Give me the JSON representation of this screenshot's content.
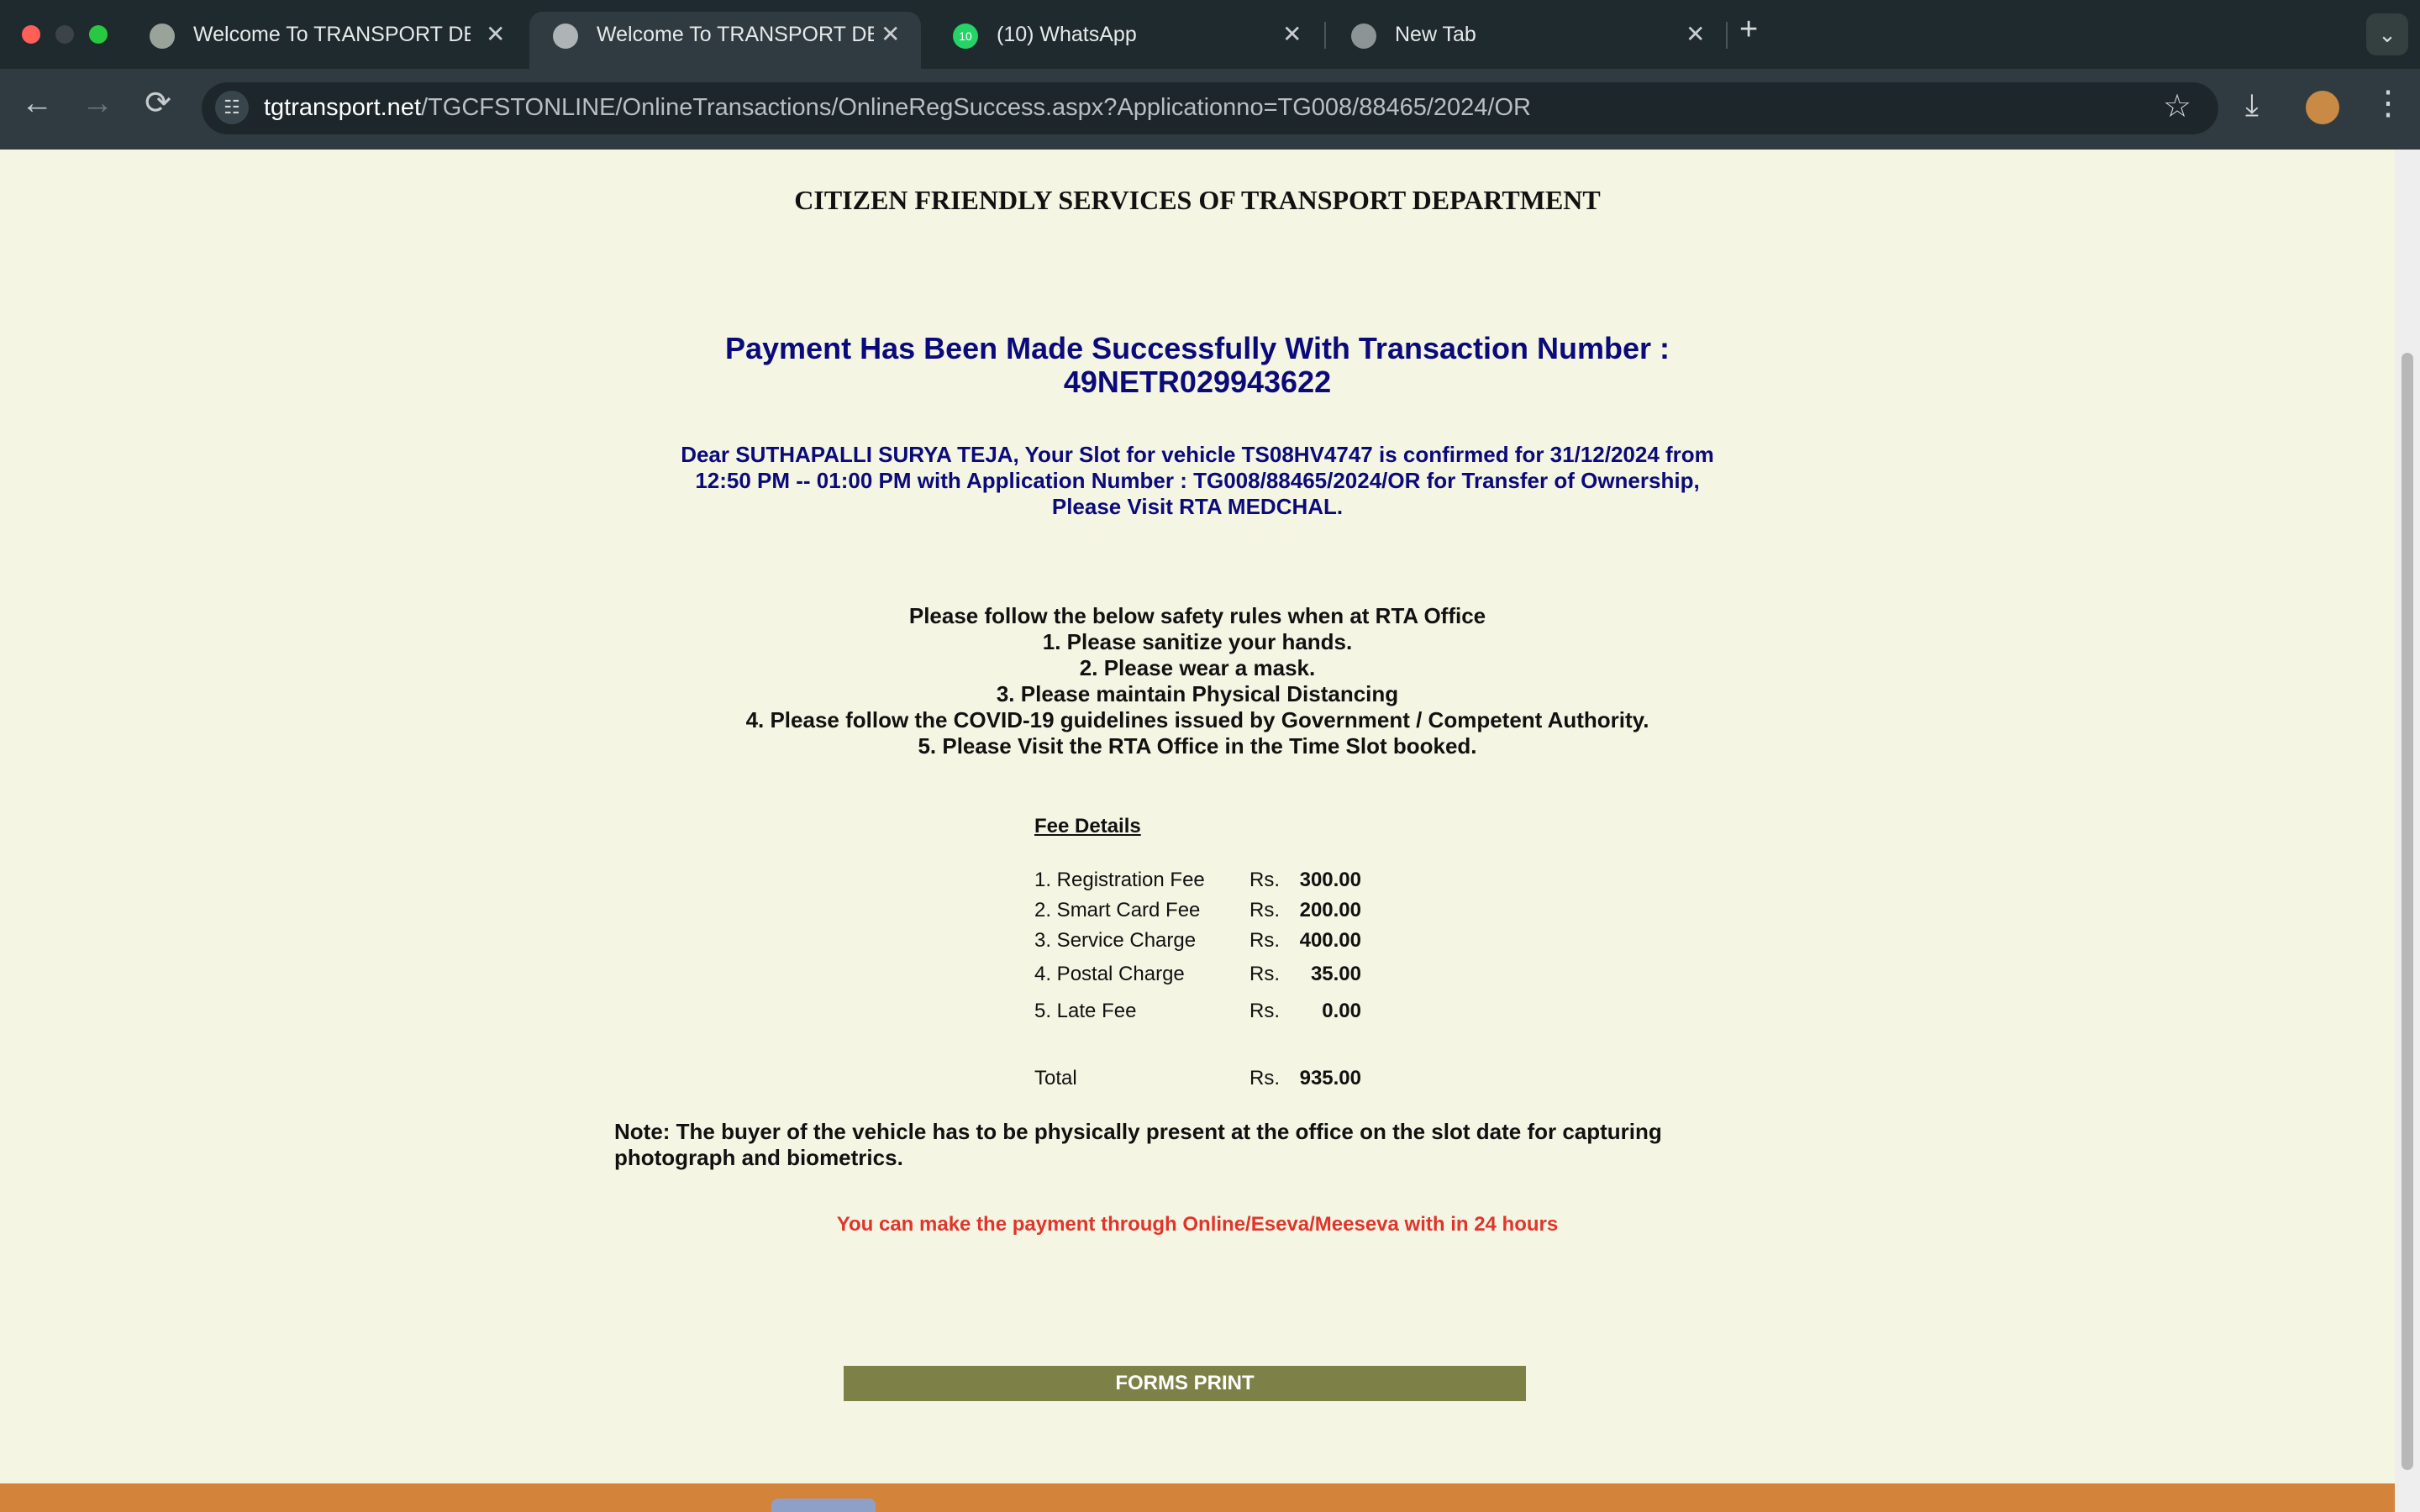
{
  "browser": {
    "tabs": [
      {
        "label": "Welcome To TRANSPORT DE"
      },
      {
        "label": "Welcome To TRANSPORT DE"
      },
      {
        "label": "(10) WhatsApp",
        "badge": "10"
      },
      {
        "label": "New Tab"
      }
    ],
    "url_host": "tgtransport.net",
    "url_path": "/TGCFSTONLINE/OnlineTransactions/OnlineRegSuccess.aspx?Applicationno=TG008/88465/2024/OR"
  },
  "page": {
    "heading": "CITIZEN FRIENDLY SERVICES OF TRANSPORT DEPARTMENT",
    "payment_line1": "Payment Has Been Made Successfully With Transaction Number :",
    "payment_line2": "49NETR029943622",
    "slot_line1": "Dear SUTHAPALLI SURYA TEJA, Your Slot for vehicle TS08HV4747 is confirmed for 31/12/2024 from",
    "slot_line2": "12:50 PM -- 01:00 PM with Application Number : TG008/88465/2024/OR for Transfer of Ownership,",
    "slot_line3": "Please Visit RTA MEDCHAL.",
    "safety_title": "Please follow the below safety rules when at RTA Office",
    "safety_rules": [
      "1. Please sanitize your hands.",
      "2. Please wear a mask.",
      "3. Please maintain Physical Distancing",
      "4. Please follow the COVID-19 guidelines issued by Government / Competent Authority.",
      "5. Please Visit the RTA Office in the Time Slot booked."
    ],
    "fee_title": "Fee Details",
    "fees": [
      {
        "label": "1. Registration Fee",
        "currency": "Rs.",
        "amount": "300.00"
      },
      {
        "label": "2. Smart Card Fee",
        "currency": "Rs.",
        "amount": "200.00"
      },
      {
        "label": "3. Service Charge",
        "currency": "Rs.",
        "amount": "400.00"
      },
      {
        "label": "4. Postal Charge",
        "currency": "Rs.",
        "amount": "35.00"
      },
      {
        "label": "5. Late Fee",
        "currency": "Rs.",
        "amount": "0.00"
      }
    ],
    "total": {
      "label": "Total",
      "currency": "Rs.",
      "amount": "935.00"
    },
    "note_line1": "Note: The buyer of the vehicle has to be physically present at the office on the slot date for capturing",
    "note_line2": "photograph and biometrics.",
    "payment_hint": "You can make the payment through Online/Eseva/Meeseva with in 24 hours",
    "forms_print": "FORMS PRINT"
  }
}
